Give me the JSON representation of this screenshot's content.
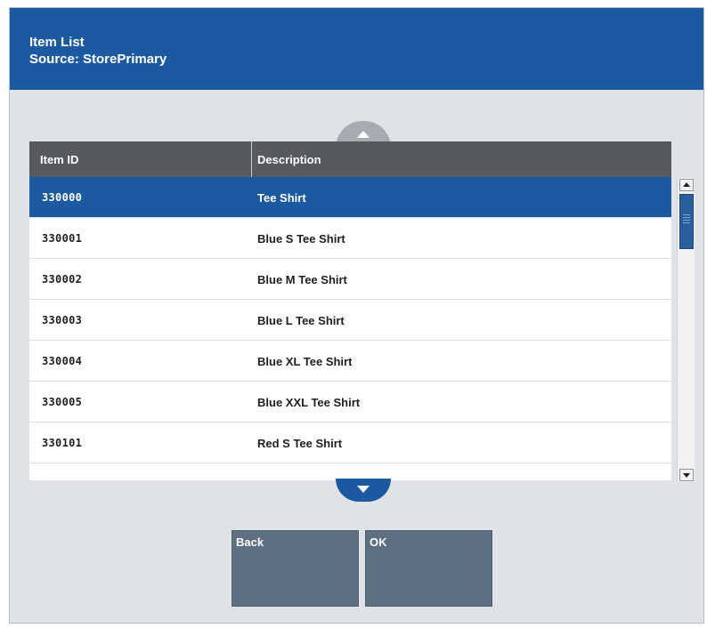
{
  "header": {
    "title": "Item List",
    "subtitle": "Source: StorePrimary"
  },
  "table": {
    "columns": [
      "Item ID",
      "Description"
    ],
    "rows": [
      {
        "id": "330000",
        "description": "Tee Shirt",
        "selected": true
      },
      {
        "id": "330001",
        "description": "Blue S Tee Shirt",
        "selected": false
      },
      {
        "id": "330002",
        "description": "Blue M Tee Shirt",
        "selected": false
      },
      {
        "id": "330003",
        "description": "Blue L Tee Shirt",
        "selected": false
      },
      {
        "id": "330004",
        "description": "Blue XL Tee Shirt",
        "selected": false
      },
      {
        "id": "330005",
        "description": "Blue XXL Tee Shirt",
        "selected": false
      },
      {
        "id": "330101",
        "description": "Red S Tee Shirt",
        "selected": false
      }
    ]
  },
  "buttons": {
    "back_label": "Back",
    "ok_label": "OK"
  },
  "icons": {
    "scroll_up": "chevron-up-icon",
    "scroll_down": "chevron-down-icon"
  },
  "colors": {
    "accent": "#1b5aa0",
    "table_header": "#56595e",
    "button": "#5e6f82",
    "background": "#dfe2e6"
  }
}
